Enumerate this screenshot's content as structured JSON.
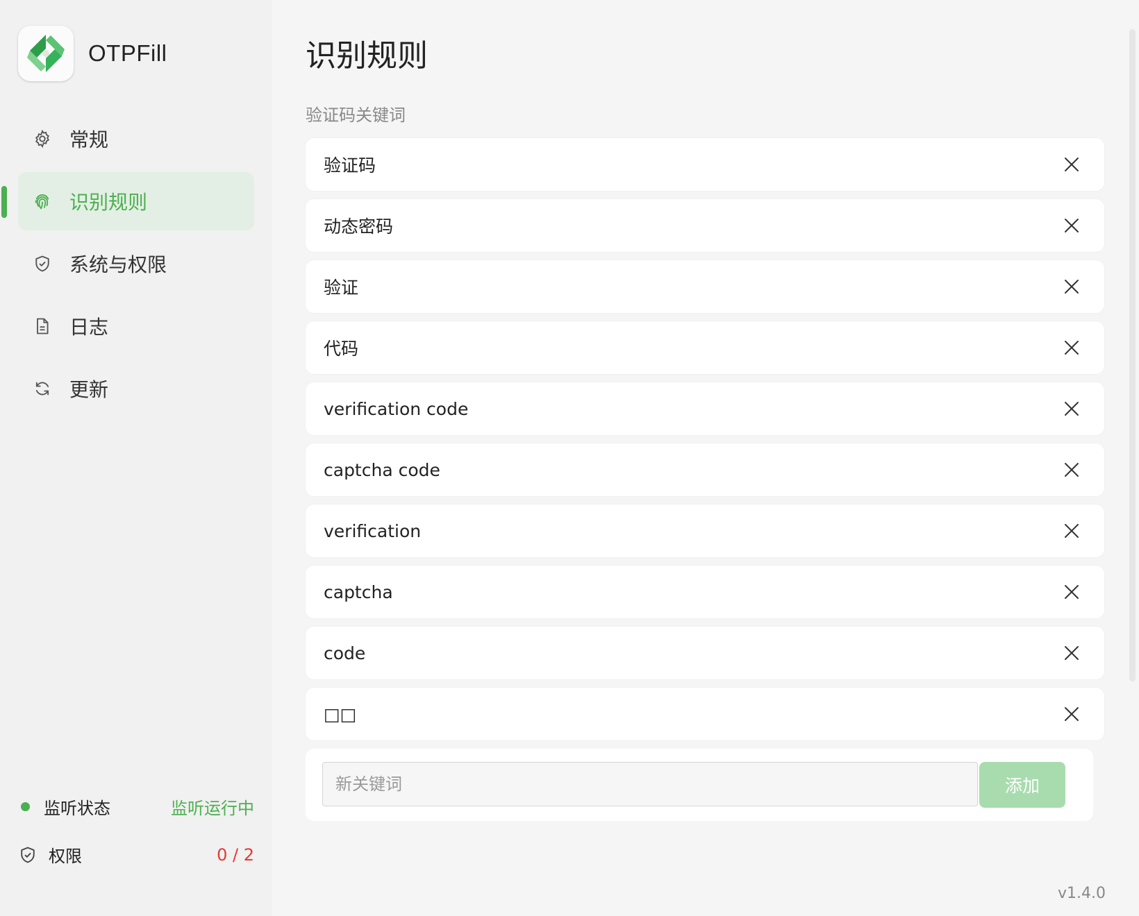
{
  "app": {
    "name": "OTPFill",
    "version": "v1.4.0"
  },
  "sidebar": {
    "items": [
      {
        "label": "常规",
        "icon": "gear-icon",
        "active": false
      },
      {
        "label": "识别规则",
        "icon": "fingerprint-icon",
        "active": true
      },
      {
        "label": "系统与权限",
        "icon": "shield-check-icon",
        "active": false
      },
      {
        "label": "日志",
        "icon": "document-icon",
        "active": false
      },
      {
        "label": "更新",
        "icon": "refresh-icon",
        "active": false
      }
    ],
    "status": {
      "label": "监听状态",
      "value": "监听运行中",
      "color": "#4caf50"
    },
    "permissions": {
      "label": "权限",
      "value": "0 / 2",
      "color": "#e53935"
    }
  },
  "main": {
    "title": "识别规则",
    "section_label": "验证码关键词",
    "keywords": [
      "验证码",
      "动态密码",
      "验证",
      "代码",
      "verification code",
      "captcha code",
      "verification",
      "captcha",
      "code",
      "□□"
    ],
    "add": {
      "placeholder": "新关键词",
      "button_label": "添加"
    }
  },
  "colors": {
    "accent": "#4caf50",
    "accent_bg": "#e3efe4",
    "button_disabled": "#a8dcae",
    "danger": "#e53935"
  }
}
